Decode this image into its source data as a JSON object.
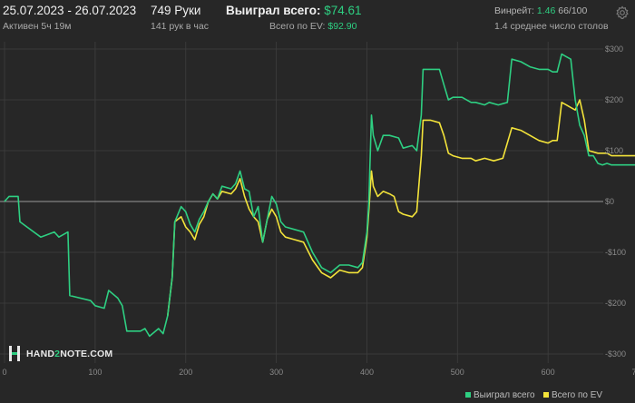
{
  "header": {
    "date_range": "25.07.2023 - 26.07.2023",
    "active": "Активен 5ч 19м",
    "hands": "749 Руки",
    "hands_per_hour": "141 рук в час",
    "won_label": "Выиграл всего:",
    "won_value": "$74.61",
    "ev_label": "Всего по EV:",
    "ev_value": "$92.90",
    "winrate_label": "Винрейт:",
    "winrate_value": "1.46",
    "winrate_unit": "66/100",
    "avg_tables": "1.4 среднее число столов"
  },
  "watermark": {
    "text_a": "HAND",
    "text_b": "2",
    "text_c": "NOTE.COM"
  },
  "colors": {
    "won": "#2ecf82",
    "ev": "#f3e33a",
    "background": "#272727",
    "grid": "#3a3a3a",
    "zero": "#9a9a9a"
  },
  "icons": {
    "settings": "gear-icon",
    "logo": "hand2note-logo-icon"
  },
  "chart_data": {
    "type": "line",
    "xlim": [
      0,
      740
    ],
    "ylim": [
      -300,
      300
    ],
    "x_ticks": [
      0,
      100,
      200,
      300,
      400,
      500,
      600,
      700
    ],
    "y_ticks": [
      300,
      200,
      100,
      0,
      -100,
      -200,
      -300
    ],
    "y_tick_labels": [
      "$300",
      "$200",
      "$100",
      "$0",
      "-$100",
      "-$200",
      "-$300"
    ],
    "grid": true,
    "legend_position": "bottom-right",
    "series": [
      {
        "name": "Выиграл всего",
        "color": "#2ecf82",
        "points": [
          [
            0,
            0
          ],
          [
            5,
            10
          ],
          [
            10,
            10
          ],
          [
            15,
            10
          ],
          [
            17,
            -40
          ],
          [
            40,
            -70
          ],
          [
            55,
            -60
          ],
          [
            60,
            -70
          ],
          [
            70,
            -60
          ],
          [
            72,
            -185
          ],
          [
            95,
            -195
          ],
          [
            100,
            -205
          ],
          [
            110,
            -210
          ],
          [
            115,
            -175
          ],
          [
            125,
            -190
          ],
          [
            130,
            -205
          ],
          [
            135,
            -255
          ],
          [
            150,
            -255
          ],
          [
            155,
            -250
          ],
          [
            160,
            -265
          ],
          [
            170,
            -250
          ],
          [
            175,
            -260
          ],
          [
            180,
            -225
          ],
          [
            185,
            -150
          ],
          [
            188,
            -40
          ],
          [
            195,
            -10
          ],
          [
            200,
            -20
          ],
          [
            205,
            -45
          ],
          [
            210,
            -60
          ],
          [
            215,
            -35
          ],
          [
            220,
            -20
          ],
          [
            225,
            0
          ],
          [
            230,
            15
          ],
          [
            235,
            5
          ],
          [
            240,
            30
          ],
          [
            250,
            25
          ],
          [
            255,
            35
          ],
          [
            260,
            60
          ],
          [
            265,
            25
          ],
          [
            270,
            20
          ],
          [
            275,
            -30
          ],
          [
            280,
            -10
          ],
          [
            285,
            -80
          ],
          [
            290,
            -35
          ],
          [
            295,
            10
          ],
          [
            300,
            -5
          ],
          [
            305,
            -40
          ],
          [
            310,
            -50
          ],
          [
            320,
            -55
          ],
          [
            330,
            -60
          ],
          [
            340,
            -100
          ],
          [
            350,
            -130
          ],
          [
            360,
            -140
          ],
          [
            370,
            -125
          ],
          [
            380,
            -125
          ],
          [
            390,
            -130
          ],
          [
            395,
            -120
          ],
          [
            400,
            -60
          ],
          [
            402,
            -5
          ],
          [
            405,
            170
          ],
          [
            407,
            130
          ],
          [
            412,
            100
          ],
          [
            418,
            130
          ],
          [
            425,
            130
          ],
          [
            435,
            125
          ],
          [
            440,
            105
          ],
          [
            450,
            110
          ],
          [
            455,
            100
          ],
          [
            460,
            170
          ],
          [
            462,
            260
          ],
          [
            470,
            260
          ],
          [
            480,
            260
          ],
          [
            485,
            230
          ],
          [
            490,
            200
          ],
          [
            495,
            205
          ],
          [
            505,
            205
          ],
          [
            515,
            195
          ],
          [
            520,
            195
          ],
          [
            530,
            190
          ],
          [
            535,
            195
          ],
          [
            545,
            190
          ],
          [
            555,
            195
          ],
          [
            560,
            280
          ],
          [
            570,
            275
          ],
          [
            580,
            265
          ],
          [
            590,
            260
          ],
          [
            600,
            260
          ],
          [
            605,
            255
          ],
          [
            610,
            255
          ],
          [
            615,
            290
          ],
          [
            620,
            285
          ],
          [
            625,
            280
          ],
          [
            630,
            200
          ],
          [
            635,
            150
          ],
          [
            640,
            130
          ],
          [
            645,
            90
          ],
          [
            650,
            90
          ],
          [
            655,
            75
          ],
          [
            660,
            72
          ],
          [
            665,
            75
          ],
          [
            670,
            72
          ],
          [
            740,
            72
          ]
        ]
      },
      {
        "name": "Всего по EV",
        "color": "#f3e33a",
        "points": [
          [
            180,
            -225
          ],
          [
            185,
            -150
          ],
          [
            188,
            -40
          ],
          [
            195,
            -30
          ],
          [
            200,
            -50
          ],
          [
            205,
            -60
          ],
          [
            210,
            -75
          ],
          [
            215,
            -45
          ],
          [
            220,
            -30
          ],
          [
            225,
            0
          ],
          [
            230,
            15
          ],
          [
            235,
            5
          ],
          [
            240,
            20
          ],
          [
            250,
            15
          ],
          [
            255,
            25
          ],
          [
            260,
            45
          ],
          [
            265,
            10
          ],
          [
            270,
            -15
          ],
          [
            275,
            -30
          ],
          [
            280,
            -40
          ],
          [
            285,
            -80
          ],
          [
            290,
            -35
          ],
          [
            295,
            -15
          ],
          [
            300,
            -30
          ],
          [
            305,
            -60
          ],
          [
            310,
            -70
          ],
          [
            320,
            -75
          ],
          [
            330,
            -80
          ],
          [
            340,
            -115
          ],
          [
            350,
            -140
          ],
          [
            360,
            -150
          ],
          [
            370,
            -135
          ],
          [
            380,
            -140
          ],
          [
            390,
            -140
          ],
          [
            395,
            -130
          ],
          [
            400,
            -70
          ],
          [
            402,
            -20
          ],
          [
            405,
            60
          ],
          [
            407,
            30
          ],
          [
            412,
            10
          ],
          [
            418,
            20
          ],
          [
            425,
            15
          ],
          [
            430,
            10
          ],
          [
            435,
            -20
          ],
          [
            440,
            -25
          ],
          [
            450,
            -30
          ],
          [
            455,
            -20
          ],
          [
            460,
            90
          ],
          [
            462,
            160
          ],
          [
            470,
            160
          ],
          [
            480,
            155
          ],
          [
            485,
            130
          ],
          [
            490,
            95
          ],
          [
            495,
            90
          ],
          [
            505,
            85
          ],
          [
            515,
            85
          ],
          [
            520,
            80
          ],
          [
            530,
            85
          ],
          [
            540,
            80
          ],
          [
            550,
            85
          ],
          [
            560,
            145
          ],
          [
            570,
            140
          ],
          [
            580,
            130
          ],
          [
            590,
            120
          ],
          [
            600,
            115
          ],
          [
            605,
            120
          ],
          [
            610,
            120
          ],
          [
            615,
            195
          ],
          [
            620,
            190
          ],
          [
            625,
            185
          ],
          [
            630,
            180
          ],
          [
            635,
            200
          ],
          [
            640,
            160
          ],
          [
            645,
            100
          ],
          [
            655,
            95
          ],
          [
            665,
            95
          ],
          [
            670,
            90
          ],
          [
            740,
            90
          ]
        ]
      }
    ]
  }
}
